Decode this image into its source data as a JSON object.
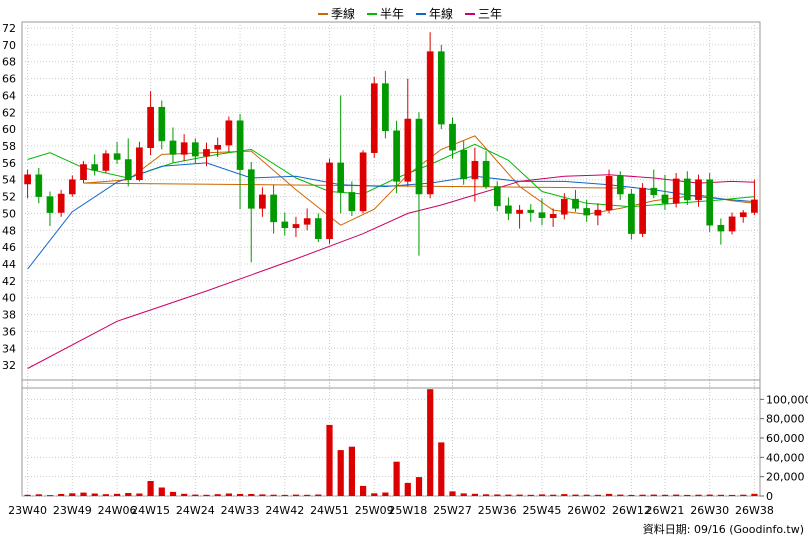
{
  "chart_data": [
    {
      "type": "candlestick",
      "title": "",
      "ylim": [
        30,
        72
      ],
      "y_ticks": [
        "72",
        "70",
        "68",
        "66",
        "64",
        "62",
        "60",
        "58",
        "56",
        "54",
        "52",
        "50",
        "48",
        "46",
        "44",
        "42",
        "40",
        "38",
        "36",
        "34",
        "32"
      ],
      "legend_position": "top-center",
      "legend": [
        {
          "label": "季線",
          "color": "#cc6600"
        },
        {
          "label": "半年",
          "color": "#00bb00"
        },
        {
          "label": "年線",
          "color": "#1166cc"
        },
        {
          "label": "三年",
          "color": "#cc0066"
        }
      ],
      "candle_colors": {
        "up": "#dd0000",
        "down": "#009900"
      },
      "ohlc": [
        [
          53.5,
          55.2,
          51.8,
          54.6
        ],
        [
          54.6,
          55.4,
          51.2,
          52.0
        ],
        [
          52.0,
          52.6,
          48.5,
          50.1
        ],
        [
          50.1,
          52.8,
          49.6,
          52.3
        ],
        [
          52.3,
          54.5,
          52.0,
          54.0
        ],
        [
          54.0,
          56.2,
          53.6,
          55.8
        ],
        [
          55.8,
          57.0,
          54.5,
          55.1
        ],
        [
          55.1,
          57.5,
          54.8,
          57.1
        ],
        [
          57.1,
          58.5,
          55.9,
          56.4
        ],
        [
          56.4,
          58.9,
          53.2,
          54.0
        ],
        [
          54.0,
          58.5,
          53.8,
          57.8
        ],
        [
          57.8,
          64.5,
          56.9,
          62.6
        ],
        [
          62.6,
          63.4,
          57.6,
          58.6
        ],
        [
          58.6,
          60.2,
          56.0,
          57.0
        ],
        [
          57.0,
          59.4,
          56.2,
          58.4
        ],
        [
          58.4,
          58.9,
          55.9,
          56.8
        ],
        [
          56.8,
          58.4,
          55.6,
          57.6
        ],
        [
          57.6,
          59.0,
          56.7,
          58.1
        ],
        [
          58.1,
          61.5,
          57.3,
          61.0
        ],
        [
          61.0,
          61.8,
          50.5,
          55.2
        ],
        [
          55.2,
          56.1,
          44.2,
          50.6
        ],
        [
          50.6,
          53.1,
          49.6,
          52.2
        ],
        [
          52.2,
          53.4,
          47.6,
          49.0
        ],
        [
          49.0,
          50.1,
          47.4,
          48.3
        ],
        [
          48.3,
          49.6,
          47.2,
          48.7
        ],
        [
          48.7,
          50.6,
          48.0,
          49.4
        ],
        [
          49.4,
          50.0,
          46.6,
          47.0
        ],
        [
          47.0,
          56.5,
          46.4,
          56.0
        ],
        [
          56.0,
          64.0,
          50.0,
          52.5
        ],
        [
          52.5,
          53.8,
          49.7,
          50.3
        ],
        [
          50.3,
          57.5,
          50.0,
          57.2
        ],
        [
          57.2,
          66.2,
          56.6,
          65.4
        ],
        [
          65.4,
          66.9,
          58.9,
          59.8
        ],
        [
          59.8,
          61.0,
          52.4,
          53.8
        ],
        [
          53.8,
          66.0,
          53.2,
          61.2
        ],
        [
          61.2,
          62.0,
          45.0,
          52.3
        ],
        [
          52.3,
          71.5,
          51.8,
          69.2
        ],
        [
          69.2,
          70.0,
          60.0,
          60.6
        ],
        [
          60.6,
          61.4,
          56.5,
          57.5
        ],
        [
          57.5,
          58.6,
          53.4,
          54.1
        ],
        [
          54.1,
          57.8,
          51.4,
          56.2
        ],
        [
          56.2,
          57.4,
          52.9,
          53.2
        ],
        [
          53.2,
          53.8,
          50.3,
          50.9
        ],
        [
          50.9,
          51.9,
          49.2,
          50.0
        ],
        [
          50.0,
          51.0,
          48.2,
          50.4
        ],
        [
          50.4,
          51.1,
          49.0,
          50.1
        ],
        [
          50.1,
          51.8,
          48.6,
          49.5
        ],
        [
          49.5,
          50.6,
          48.4,
          49.9
        ],
        [
          49.9,
          52.4,
          49.3,
          51.7
        ],
        [
          51.7,
          52.8,
          50.2,
          50.6
        ],
        [
          50.6,
          51.6,
          49.0,
          49.8
        ],
        [
          49.8,
          51.2,
          48.6,
          50.4
        ],
        [
          50.4,
          55.2,
          50.0,
          54.4
        ],
        [
          54.4,
          55.0,
          51.6,
          52.3
        ],
        [
          52.3,
          52.9,
          46.9,
          47.6
        ],
        [
          47.6,
          53.6,
          47.2,
          53.0
        ],
        [
          53.0,
          55.2,
          51.8,
          52.2
        ],
        [
          52.2,
          54.6,
          50.4,
          51.2
        ],
        [
          51.2,
          54.8,
          50.7,
          54.1
        ],
        [
          54.1,
          55.0,
          51.0,
          51.6
        ],
        [
          51.6,
          54.6,
          50.8,
          54.0
        ],
        [
          54.0,
          54.8,
          47.8,
          48.6
        ],
        [
          48.6,
          49.4,
          46.3,
          47.9
        ],
        [
          47.9,
          50.1,
          47.5,
          49.6
        ],
        [
          49.6,
          50.4,
          48.9,
          50.1
        ],
        [
          50.1,
          54.0,
          49.8,
          51.6
        ]
      ],
      "volume": [
        1200,
        1800,
        900,
        2100,
        2800,
        3500,
        2600,
        1900,
        2300,
        3100,
        2600,
        15500,
        8800,
        4200,
        2300,
        1500,
        1200,
        1900,
        2600,
        2200,
        2100,
        1700,
        1300,
        1100,
        1400,
        1200,
        1600,
        73500,
        47500,
        51000,
        10500,
        2800,
        3600,
        35500,
        13500,
        19500,
        110500,
        55500,
        4800,
        2700,
        2300,
        1800,
        1600,
        1400,
        1500,
        1200,
        1700,
        1300,
        2000,
        1500,
        1300,
        1200,
        2200,
        1400,
        1100,
        1300,
        1500,
        1200,
        1400,
        1100,
        1300,
        1400,
        1200,
        1100,
        1300,
        2300
      ],
      "vol_ylim": [
        0,
        120000
      ],
      "vol_ticks": [
        {
          "value": 100000,
          "label": "100,000"
        },
        {
          "value": 80000,
          "label": "80,000"
        },
        {
          "value": 60000,
          "label": "60,000"
        },
        {
          "value": 40000,
          "label": "40,000"
        },
        {
          "value": 20000,
          "label": "20,000"
        },
        {
          "value": 0,
          "label": "0"
        }
      ],
      "x_ticks": [
        "23W40",
        "23W49",
        "24W06",
        "24W15",
        "24W24",
        "24W33",
        "24W42",
        "24W51",
        "25W09",
        "25W18",
        "25W27",
        "25W36",
        "25W45",
        "26W02",
        "26W12",
        "26W21",
        "26W30",
        "26W38"
      ],
      "ma": {
        "季線": [
          [
            53.5,
            53.0
          ],
          [
            5,
            53.6
          ],
          [
            9,
            54.0
          ],
          [
            12,
            57.0
          ],
          [
            16,
            57.2
          ],
          [
            20,
            57.4
          ],
          [
            24,
            52.8
          ],
          [
            28,
            48.6
          ],
          [
            31,
            50.5
          ],
          [
            34,
            54.6
          ],
          [
            37,
            57.6
          ],
          [
            40,
            59.2
          ],
          [
            44,
            53.2
          ],
          [
            47,
            50.4
          ],
          [
            50,
            49.9
          ],
          [
            53,
            50.6
          ],
          [
            56,
            51.5
          ],
          [
            60,
            52.2
          ],
          [
            63,
            51.5
          ],
          [
            65,
            51.2
          ]
        ],
        "半年": [
          [
            0,
            56.4
          ],
          [
            2,
            57.2
          ],
          [
            5,
            55.4
          ],
          [
            9,
            54.2
          ],
          [
            13,
            56.0
          ],
          [
            17,
            57.0
          ],
          [
            20,
            57.6
          ],
          [
            24,
            54.2
          ],
          [
            27,
            52.6
          ],
          [
            30,
            52.3
          ],
          [
            33,
            54.2
          ],
          [
            36,
            55.8
          ],
          [
            40,
            58.2
          ],
          [
            43,
            56.3
          ],
          [
            46,
            52.6
          ],
          [
            50,
            51.2
          ],
          [
            54,
            50.8
          ],
          [
            58,
            51.2
          ],
          [
            62,
            51.6
          ],
          [
            65,
            52.0
          ]
        ],
        "年線": [
          [
            0,
            43.4
          ],
          [
            4,
            50.2
          ],
          [
            8,
            53.7
          ],
          [
            12,
            55.6
          ],
          [
            16,
            56.0
          ],
          [
            20,
            54.2
          ],
          [
            24,
            54.4
          ],
          [
            28,
            53.4
          ],
          [
            32,
            53.2
          ],
          [
            36,
            53.6
          ],
          [
            40,
            54.4
          ],
          [
            44,
            53.8
          ],
          [
            48,
            53.8
          ],
          [
            52,
            53.4
          ],
          [
            56,
            52.8
          ],
          [
            60,
            52.0
          ],
          [
            63,
            51.6
          ],
          [
            65,
            51.4
          ]
        ],
        "三年": [
          [
            0,
            31.6
          ],
          [
            8,
            37.2
          ],
          [
            16,
            40.8
          ],
          [
            24,
            44.6
          ],
          [
            30,
            47.6
          ],
          [
            34,
            50.0
          ],
          [
            37,
            51.0
          ],
          [
            40,
            52.2
          ],
          [
            44,
            53.8
          ],
          [
            48,
            54.4
          ],
          [
            52,
            54.6
          ],
          [
            56,
            54.2
          ],
          [
            60,
            53.6
          ],
          [
            63,
            53.8
          ],
          [
            65,
            53.7
          ]
        ]
      }
    }
  ],
  "source_label": "資料日期: 09/16 (Goodinfo.tw)"
}
